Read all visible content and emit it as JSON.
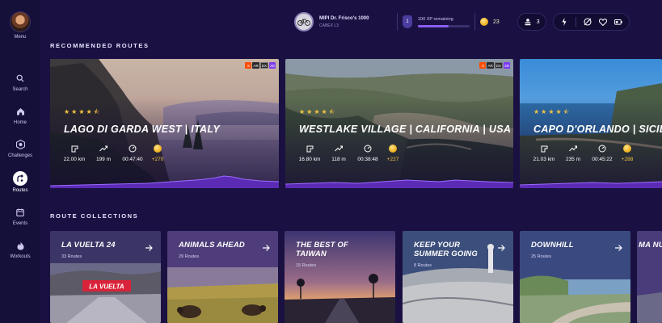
{
  "sidebar": {
    "menu_label": "Menu",
    "items": [
      {
        "label": "Search",
        "icon": "search-icon"
      },
      {
        "label": "Home",
        "icon": "home-icon"
      },
      {
        "label": "Challenges",
        "icon": "challenges-icon"
      },
      {
        "label": "Routes",
        "icon": "routes-icon",
        "active": true
      },
      {
        "label": "Events",
        "icon": "calendar-icon"
      },
      {
        "label": "Workouts",
        "icon": "flame-icon"
      }
    ]
  },
  "topbar": {
    "bike_name": "MIPI Dr. Frisco's 1000",
    "bike_sub": "CABEX L3",
    "level": "1",
    "xp_text": "100 XP remaining",
    "xp_progress": 0.6,
    "coins": "23",
    "people_count": "3"
  },
  "sections": {
    "recommended": "RECOMMENDED ROUTES",
    "collections": "ROUTE COLLECTIONS"
  },
  "routes": [
    {
      "title": "LAGO DI GARDA WEST | ITALY",
      "rating": 4.5,
      "distance": "22.00 km",
      "elevation": "199 m",
      "time": "00:47:40",
      "xp": "+270",
      "badges": [
        "S",
        "AR",
        "DX",
        "3D"
      ]
    },
    {
      "title": "WESTLAKE VILLAGE | CALIFORNIA | USA",
      "rating": 4.5,
      "distance": "16.80 km",
      "elevation": "118 m",
      "time": "00:38:48",
      "xp": "+227",
      "badges": [
        "S",
        "AR",
        "DX",
        "3D"
      ]
    },
    {
      "title": "CAPO D'ORLANDO | SICILY",
      "rating": 4.5,
      "distance": "21.03 km",
      "elevation": "235 m",
      "time": "00:45:22",
      "xp": "+288",
      "badges": []
    }
  ],
  "collections": [
    {
      "title": "LA VUELTA 24",
      "count": "33 Routes"
    },
    {
      "title": "ANIMALS AHEAD",
      "count": "29 Routes"
    },
    {
      "title": "THE BEST OF TAIWAN",
      "count": "15 Routes"
    },
    {
      "title": "KEEP YOUR SUMMER GOING",
      "count": "8 Routes"
    },
    {
      "title": "DOWNHILL",
      "count": "25 Routes"
    },
    {
      "title": "MA NUR",
      "count": ""
    }
  ],
  "extras": {
    "la_vuelta_sign": "LA VUELTA"
  },
  "colors": {
    "background": "#1a1142",
    "sidebar": "#15103a",
    "accent_purple": "#7c3aed",
    "xp_gold": "#f5c542"
  }
}
